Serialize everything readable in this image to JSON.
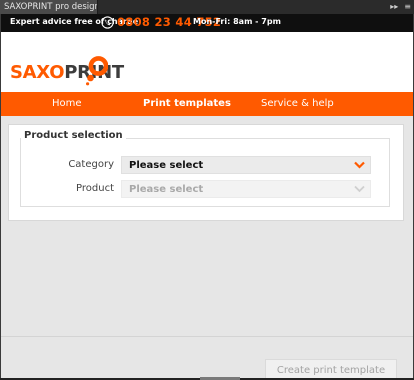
{
  "window": {
    "title": "SAXOPRINT pro design",
    "controls": [
      "▸▸",
      "≡"
    ]
  },
  "topbar": {
    "advice": "Expert advice free of charge",
    "phone": "0808 23 44 752",
    "hours": "Mon-Fri: 8am - 7pm"
  },
  "logo": {
    "saxo": "SAXO",
    "print": "PRINT"
  },
  "nav": {
    "items": [
      {
        "label": "Home"
      },
      {
        "label": "Print templates"
      },
      {
        "label": "Service & help"
      }
    ]
  },
  "product_selection": {
    "legend": "Product selection",
    "category": {
      "label": "Category",
      "value": "Please select"
    },
    "product": {
      "label": "Product",
      "value": "Please select"
    }
  },
  "footer": {
    "create_button": "Create print template"
  },
  "colors": {
    "brand": "#ff5a00",
    "topbar": "#0f0f0f",
    "panel_bg": "#e6e6e6"
  }
}
